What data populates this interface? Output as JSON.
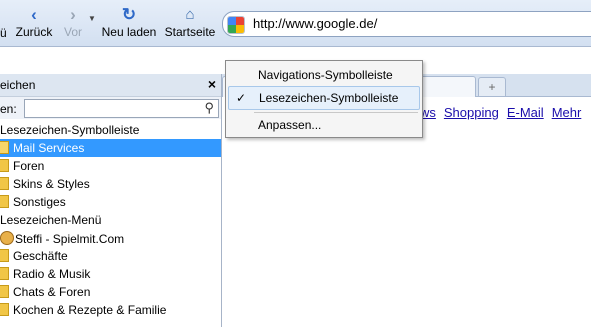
{
  "toolbar": {
    "left_cut_label": "ü",
    "back_label": "Zurück",
    "forward_label": "Vor",
    "reload_label": "Neu laden",
    "home_label": "Startseite",
    "back_icon": "‹",
    "forward_icon": "›",
    "reload_icon": "↻",
    "home_icon": "⌂"
  },
  "address_bar": {
    "url": "http://www.google.de/"
  },
  "sidebar": {
    "title": "eichen",
    "close_icon": "×",
    "search_label": "en:",
    "search_value": "",
    "items": [
      {
        "label": "Lesezeichen-Symbolleiste",
        "type": "header"
      },
      {
        "label": "Mail Services",
        "type": "folder",
        "selected": true
      },
      {
        "label": "Foren",
        "type": "folder"
      },
      {
        "label": "Skins & Styles",
        "type": "folder"
      },
      {
        "label": "Sonstiges",
        "type": "folder"
      },
      {
        "label": "Lesezeichen-Menü",
        "type": "header"
      },
      {
        "label": "Steffi - Spielmit.Com",
        "type": "bookmark"
      },
      {
        "label": "Geschäfte",
        "type": "folder"
      },
      {
        "label": "Radio & Musik",
        "type": "folder"
      },
      {
        "label": "Chats & Foren",
        "type": "folder"
      },
      {
        "label": "Kochen & Rezepte & Familie",
        "type": "folder"
      }
    ]
  },
  "tabs": {
    "new_tab_icon": "+"
  },
  "content": {
    "links": [
      "ws",
      "Shopping",
      "E-Mail",
      "Mehr"
    ]
  },
  "context_menu": {
    "items": [
      {
        "label": "Navigations-Symbolleiste",
        "checked": false
      },
      {
        "label": "Lesezeichen-Symbolleiste",
        "checked": true
      },
      {
        "label": "Anpassen...",
        "checked": false
      }
    ],
    "check_icon": "✓"
  }
}
